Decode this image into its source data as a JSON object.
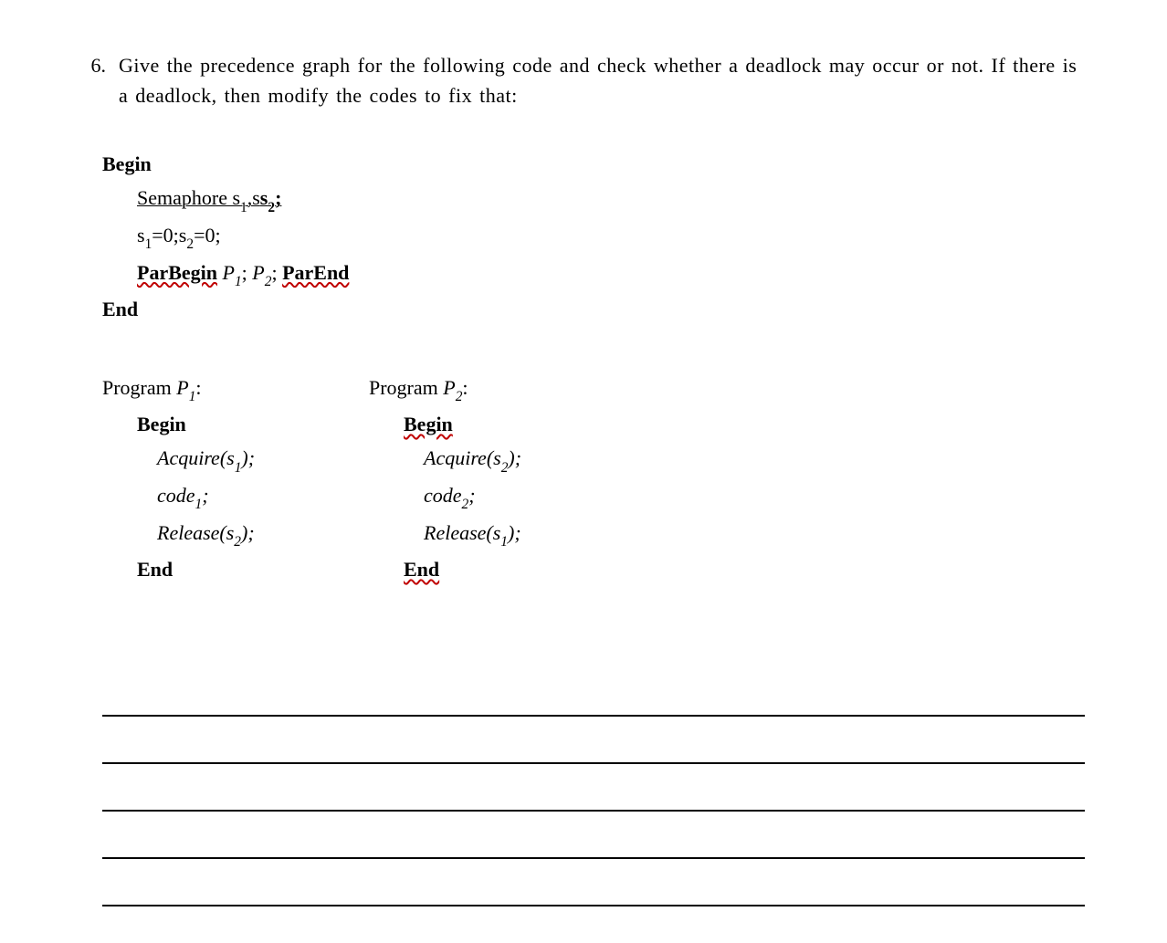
{
  "question": {
    "number": "6.",
    "text": "Give the precedence graph for the following code and check whether a deadlock may occur or not. If there is a deadlock, then modify the codes to fix that:"
  },
  "main_block": {
    "begin": "Begin",
    "semaphore_label": "Semaphore",
    "semaphore_vars": " s",
    "semaphore_sub1": "1",
    "semaphore_comma": ",s",
    "semaphore_sub2": "2",
    "semaphore_semi": ";",
    "init_s1": "s",
    "init_s1_sub": "1",
    "init_eq1": "=0;s",
    "init_s2_sub": "2",
    "init_eq2": "=0;",
    "parbegin": "ParBegin",
    "p1": " P",
    "p1_sub": "1",
    "p_semi1": "; ",
    "p2": "P",
    "p2_sub": "2",
    "p_semi2": "; ",
    "parend": "ParEnd",
    "end": "End"
  },
  "program1": {
    "header_label": "Program",
    "header_p": " P",
    "header_sub": "1",
    "header_colon": ":",
    "begin": "Begin",
    "acquire": "Acquire(s",
    "acquire_sub": "1",
    "acquire_close": ");",
    "code": "code",
    "code_sub": "1",
    "code_semi": ";",
    "release": "Release(s",
    "release_sub": "2",
    "release_close": ");",
    "end": "End"
  },
  "program2": {
    "header_label": "Program ",
    "header_p": "P",
    "header_sub": "2",
    "header_colon": ":",
    "begin": "Begin",
    "acquire": "Acquire(s",
    "acquire_sub": "2",
    "acquire_close": ");",
    "code": "code",
    "code_sub": "2",
    "code_semi": ";",
    "release": "Release(s",
    "release_sub": "1",
    "release_close": ");",
    "end": "End"
  }
}
